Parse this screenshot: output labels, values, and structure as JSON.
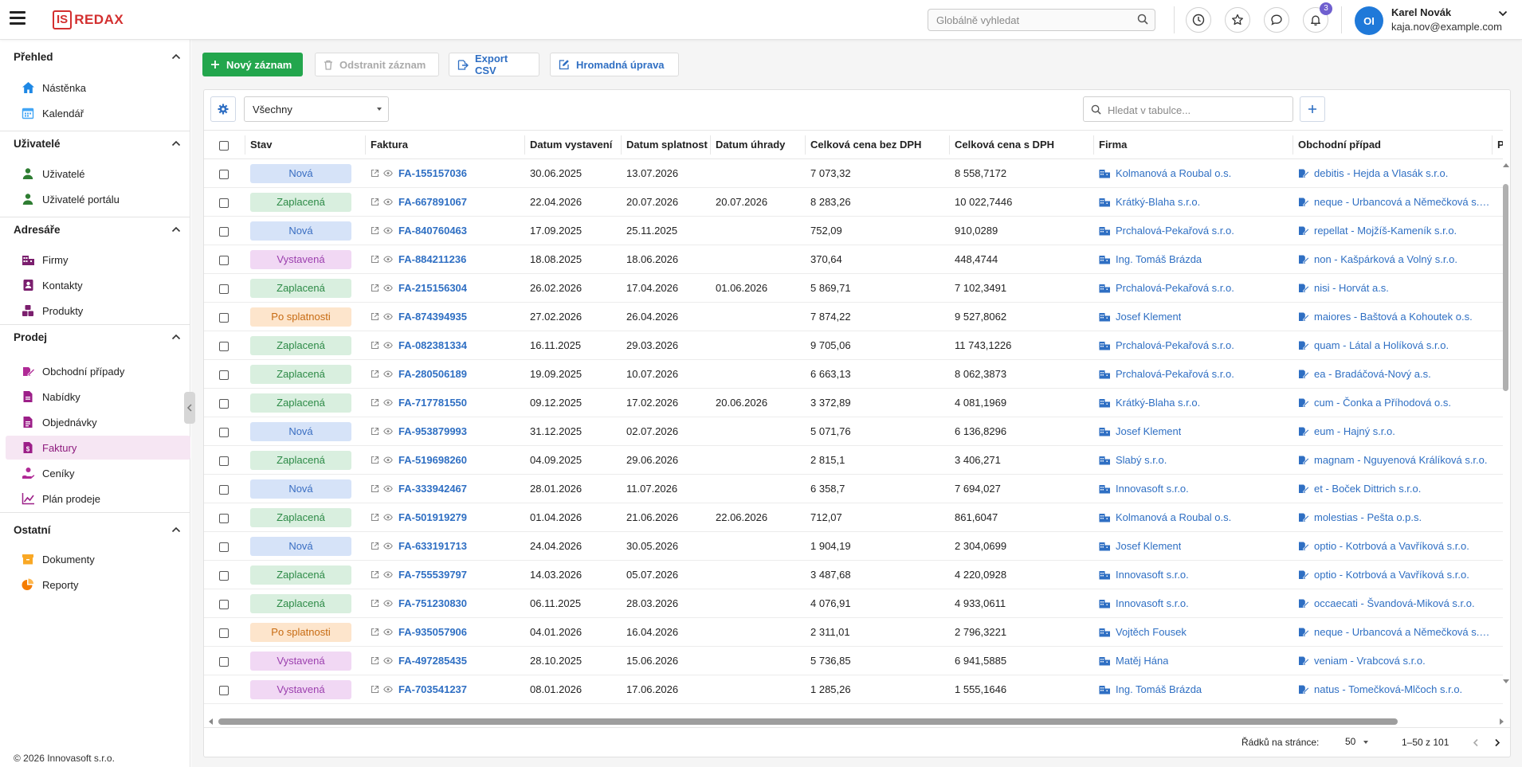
{
  "header": {
    "logo_box": "IS",
    "logo_text": "REDAX",
    "search_placeholder": "Globálně vyhledat",
    "notifications_count": "3",
    "avatar_initials": "OI",
    "user_name": "Karel Novák",
    "user_email": "kaja.nov@example.com"
  },
  "sidebar": {
    "sections": [
      {
        "title": "Přehled",
        "items": [
          {
            "label": "Nástěnka",
            "icon": "home-icon"
          },
          {
            "label": "Kalendář",
            "icon": "calendar-icon"
          }
        ]
      },
      {
        "title": "Uživatelé",
        "items": [
          {
            "label": "Uživatelé",
            "icon": "user-icon"
          },
          {
            "label": "Uživatelé portálu",
            "icon": "portal-user-icon"
          }
        ]
      },
      {
        "title": "Adresáře",
        "items": [
          {
            "label": "Firmy",
            "icon": "company-icon"
          },
          {
            "label": "Kontakty",
            "icon": "contact-icon"
          },
          {
            "label": "Produkty",
            "icon": "product-icon"
          }
        ]
      },
      {
        "title": "Prodej",
        "items": [
          {
            "label": "Obchodní případy",
            "icon": "deal-icon"
          },
          {
            "label": "Nabídky",
            "icon": "offer-icon"
          },
          {
            "label": "Objednávky",
            "icon": "order-icon"
          },
          {
            "label": "Faktury",
            "icon": "invoice-icon",
            "active": true
          },
          {
            "label": "Ceníky",
            "icon": "pricelist-icon"
          },
          {
            "label": "Plán prodeje",
            "icon": "sales-plan-icon"
          }
        ]
      },
      {
        "title": "Ostatní",
        "items": [
          {
            "label": "Dokumenty",
            "icon": "documents-icon"
          },
          {
            "label": "Reporty",
            "icon": "reports-icon"
          }
        ]
      }
    ],
    "footer": "© 2026 Innovasoft s.r.o."
  },
  "toolbar": {
    "new_label": "Nový záznam",
    "delete_label": "Odstranit záznam",
    "export_label": "Export CSV",
    "bulk_label": "Hromadná úprava"
  },
  "table": {
    "filter_value": "Všechny",
    "search_placeholder": "Hledat v tabulce...",
    "columns": [
      "Stav",
      "Faktura",
      "Datum vystavení",
      "Datum splatnost",
      "Datum úhrady",
      "Celková cena bez DPH",
      "Celková cena s DPH",
      "Firma",
      "Obchodní případ",
      "Př"
    ],
    "rows": [
      {
        "status": "Nová",
        "invoice": "FA-155157036",
        "issued": "30.06.2025",
        "due": "13.07.2026",
        "paid": "",
        "net": "7 073,32",
        "gross": "8 558,7172",
        "company": "Kolmanová a Roubal o.s.",
        "deal": "debitis - Hejda a Vlasák s.r.o."
      },
      {
        "status": "Zaplacená",
        "invoice": "FA-667891067",
        "issued": "22.04.2026",
        "due": "20.07.2026",
        "paid": "20.07.2026",
        "net": "8 283,26",
        "gross": "10 022,7446",
        "company": "Krátký-Blaha s.r.o.",
        "deal": "neque - Urbancová a Němečková s.r.o."
      },
      {
        "status": "Nová",
        "invoice": "FA-840760463",
        "issued": "17.09.2025",
        "due": "25.11.2025",
        "paid": "",
        "net": "752,09",
        "gross": "910,0289",
        "company": "Prchalová-Pekařová s.r.o.",
        "deal": "repellat - Mojžíš-Kameník s.r.o."
      },
      {
        "status": "Vystavená",
        "invoice": "FA-884211236",
        "issued": "18.08.2025",
        "due": "18.06.2026",
        "paid": "",
        "net": "370,64",
        "gross": "448,4744",
        "company": "Ing. Tomáš Brázda",
        "deal": "non - Kašpárková a Volný s.r.o."
      },
      {
        "status": "Zaplacená",
        "invoice": "FA-215156304",
        "issued": "26.02.2026",
        "due": "17.04.2026",
        "paid": "01.06.2026",
        "net": "5 869,71",
        "gross": "7 102,3491",
        "company": "Prchalová-Pekařová s.r.o.",
        "deal": "nisi - Horvát a.s."
      },
      {
        "status": "Po splatnosti",
        "invoice": "FA-874394935",
        "issued": "27.02.2026",
        "due": "26.04.2026",
        "paid": "",
        "net": "7 874,22",
        "gross": "9 527,8062",
        "company": "Josef Klement",
        "deal": "maiores - Baštová a Kohoutek o.s."
      },
      {
        "status": "Zaplacená",
        "invoice": "FA-082381334",
        "issued": "16.11.2025",
        "due": "29.03.2026",
        "paid": "",
        "net": "9 705,06",
        "gross": "11 743,1226",
        "company": "Prchalová-Pekařová s.r.o.",
        "deal": "quam - Látal a Holíková s.r.o."
      },
      {
        "status": "Zaplacená",
        "invoice": "FA-280506189",
        "issued": "19.09.2025",
        "due": "10.07.2026",
        "paid": "",
        "net": "6 663,13",
        "gross": "8 062,3873",
        "company": "Prchalová-Pekařová s.r.o.",
        "deal": "ea - Bradáčová-Nový a.s."
      },
      {
        "status": "Zaplacená",
        "invoice": "FA-717781550",
        "issued": "09.12.2025",
        "due": "17.02.2026",
        "paid": "20.06.2026",
        "net": "3 372,89",
        "gross": "4 081,1969",
        "company": "Krátký-Blaha s.r.o.",
        "deal": "cum - Čonka a Příhodová o.s."
      },
      {
        "status": "Nová",
        "invoice": "FA-953879993",
        "issued": "31.12.2025",
        "due": "02.07.2026",
        "paid": "",
        "net": "5 071,76",
        "gross": "6 136,8296",
        "company": "Josef Klement",
        "deal": "eum - Hajný s.r.o."
      },
      {
        "status": "Zaplacená",
        "invoice": "FA-519698260",
        "issued": "04.09.2025",
        "due": "29.06.2026",
        "paid": "",
        "net": "2 815,1",
        "gross": "3 406,271",
        "company": "Slabý s.r.o.",
        "deal": "magnam - Nguyenová Králíková s.r.o."
      },
      {
        "status": "Nová",
        "invoice": "FA-333942467",
        "issued": "28.01.2026",
        "due": "11.07.2026",
        "paid": "",
        "net": "6 358,7",
        "gross": "7 694,027",
        "company": "Innovasoft s.r.o.",
        "deal": "et - Boček Dittrich s.r.o."
      },
      {
        "status": "Zaplacená",
        "invoice": "FA-501919279",
        "issued": "01.04.2026",
        "due": "21.06.2026",
        "paid": "22.06.2026",
        "net": "712,07",
        "gross": "861,6047",
        "company": "Kolmanová a Roubal o.s.",
        "deal": "molestias - Pešta o.p.s."
      },
      {
        "status": "Nová",
        "invoice": "FA-633191713",
        "issued": "24.04.2026",
        "due": "30.05.2026",
        "paid": "",
        "net": "1 904,19",
        "gross": "2 304,0699",
        "company": "Josef Klement",
        "deal": "optio - Kotrbová a Vavříková s.r.o."
      },
      {
        "status": "Zaplacená",
        "invoice": "FA-755539797",
        "issued": "14.03.2026",
        "due": "05.07.2026",
        "paid": "",
        "net": "3 487,68",
        "gross": "4 220,0928",
        "company": "Innovasoft s.r.o.",
        "deal": "optio - Kotrbová a Vavříková s.r.o."
      },
      {
        "status": "Zaplacená",
        "invoice": "FA-751230830",
        "issued": "06.11.2025",
        "due": "28.03.2026",
        "paid": "",
        "net": "4 076,91",
        "gross": "4 933,0611",
        "company": "Innovasoft s.r.o.",
        "deal": "occaecati - Švandová-Miková s.r.o."
      },
      {
        "status": "Po splatnosti",
        "invoice": "FA-935057906",
        "issued": "04.01.2026",
        "due": "16.04.2026",
        "paid": "",
        "net": "2 311,01",
        "gross": "2 796,3221",
        "company": "Vojtěch Fousek",
        "deal": "neque - Urbancová a Němečková s.r.o."
      },
      {
        "status": "Vystavená",
        "invoice": "FA-497285435",
        "issued": "28.10.2025",
        "due": "15.06.2026",
        "paid": "",
        "net": "5 736,85",
        "gross": "6 941,5885",
        "company": "Matěj Hána",
        "deal": "veniam - Vrabcová s.r.o."
      },
      {
        "status": "Vystavená",
        "invoice": "FA-703541237",
        "issued": "08.01.2026",
        "due": "17.06.2026",
        "paid": "",
        "net": "1 285,26",
        "gross": "1 555,1646",
        "company": "Ing. Tomáš Brázda",
        "deal": "natus - Tomečková-Mlčoch s.r.o."
      }
    ]
  },
  "pager": {
    "rows_label": "Řádků na stránce:",
    "rows_per_page": "50",
    "range": "1–50 z 101"
  },
  "colors": {
    "primary_green": "#23a64d",
    "link_blue": "#2f6fc3",
    "active_purple": "#8e1b7e",
    "brand_red": "#d32f2f"
  }
}
